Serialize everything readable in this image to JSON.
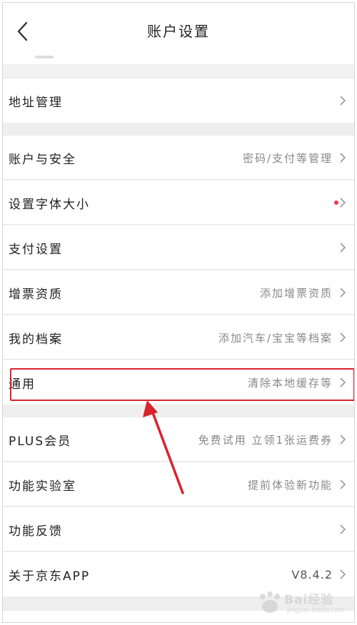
{
  "header": {
    "title": "账户设置"
  },
  "rows": [
    {
      "label": "地址管理",
      "value": ""
    },
    {
      "label": "账户与安全",
      "value": "密码/支付等管理"
    },
    {
      "label": "设置字体大小",
      "value": ""
    },
    {
      "label": "支付设置",
      "value": ""
    },
    {
      "label": "增票资质",
      "value": "添加增票资质"
    },
    {
      "label": "我的档案",
      "value": "添加汽车/宝宝等档案"
    },
    {
      "label": "通用",
      "value": "清除本地缓存等"
    },
    {
      "label": "PLUS会员",
      "value": "免费试用 立领1张运费券"
    },
    {
      "label": "功能实验室",
      "value": "提前体验新功能"
    },
    {
      "label": "功能反馈",
      "value": ""
    },
    {
      "label": "关于京东APP",
      "value": "V8.4.2"
    }
  ],
  "colors": {
    "accent": "#d9232e",
    "badge": "#f0384a"
  },
  "watermark": {
    "text": "Bai经验",
    "sub": "jingyan.baidu.com"
  }
}
